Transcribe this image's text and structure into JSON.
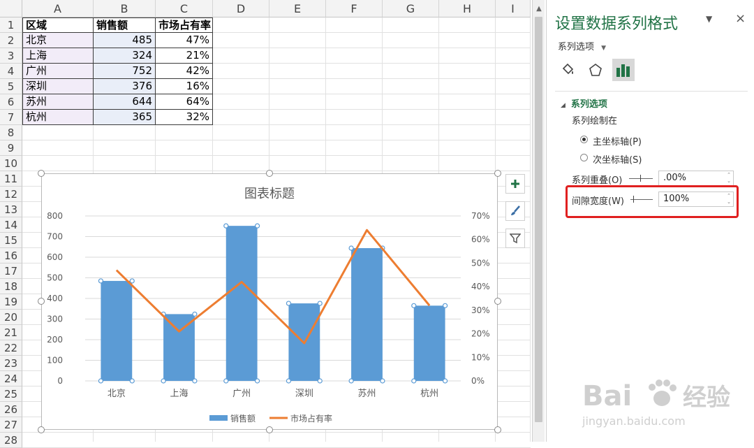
{
  "spreadsheet": {
    "columns": [
      "A",
      "B",
      "C",
      "D",
      "E",
      "F",
      "G",
      "H",
      "I"
    ],
    "rows": [
      "1",
      "2",
      "3",
      "4",
      "5",
      "6",
      "7",
      "8",
      "9",
      "10",
      "11",
      "12",
      "13",
      "14",
      "15",
      "16",
      "17",
      "18",
      "19",
      "20",
      "21",
      "22",
      "23",
      "24",
      "25",
      "26",
      "27",
      "28"
    ],
    "table": {
      "headers": [
        "区域",
        "销售额",
        "市场占有率"
      ],
      "data": [
        [
          "北京",
          "485",
          "47%"
        ],
        [
          "上海",
          "324",
          "21%"
        ],
        [
          "广州",
          "752",
          "42%"
        ],
        [
          "深圳",
          "376",
          "16%"
        ],
        [
          "苏州",
          "644",
          "64%"
        ],
        [
          "杭州",
          "365",
          "32%"
        ]
      ]
    }
  },
  "chart_data": {
    "type": "bar",
    "title": "图表标题",
    "categories": [
      "北京",
      "上海",
      "广州",
      "深圳",
      "苏州",
      "杭州"
    ],
    "series": [
      {
        "name": "销售额",
        "type": "bar",
        "axis": "left",
        "values": [
          485,
          324,
          752,
          376,
          644,
          365
        ]
      },
      {
        "name": "市场占有率",
        "type": "line",
        "axis": "right",
        "values": [
          47,
          21,
          42,
          16,
          64,
          32
        ]
      }
    ],
    "y_left": {
      "ylim": [
        0,
        800
      ],
      "ticks": [
        "0",
        "100",
        "200",
        "300",
        "400",
        "500",
        "600",
        "700",
        "800"
      ]
    },
    "y_right": {
      "ylim": [
        0,
        70
      ],
      "ticks": [
        "0%",
        "10%",
        "20%",
        "30%",
        "40%",
        "50%",
        "60%",
        "70%"
      ]
    },
    "grid": true,
    "legend": "bottom",
    "colors": {
      "bar": "#5b9bd5",
      "line": "#ed7d31"
    }
  },
  "chart_tools": {
    "add_element": "plus-icon",
    "styles": "brush-icon",
    "filter": "filter-icon"
  },
  "format_pane": {
    "title": "设置数据系列格式",
    "options_dropdown": "系列选项",
    "section": "系列选项",
    "plot_on_label": "系列绘制在",
    "primary_axis": "主坐标轴(P)",
    "secondary_axis": "次坐标轴(S)",
    "overlap_label": "系列重叠(O)",
    "overlap_value": ".00%",
    "gap_label": "间隙宽度(W)",
    "gap_value": "100%",
    "close": "×",
    "pin": "▼",
    "accent": "#217346",
    "highlight": "#e02020"
  },
  "watermark": {
    "brand": "Bai",
    "brand_suffix": "经验",
    "url": "jingyan.baidu.com"
  }
}
